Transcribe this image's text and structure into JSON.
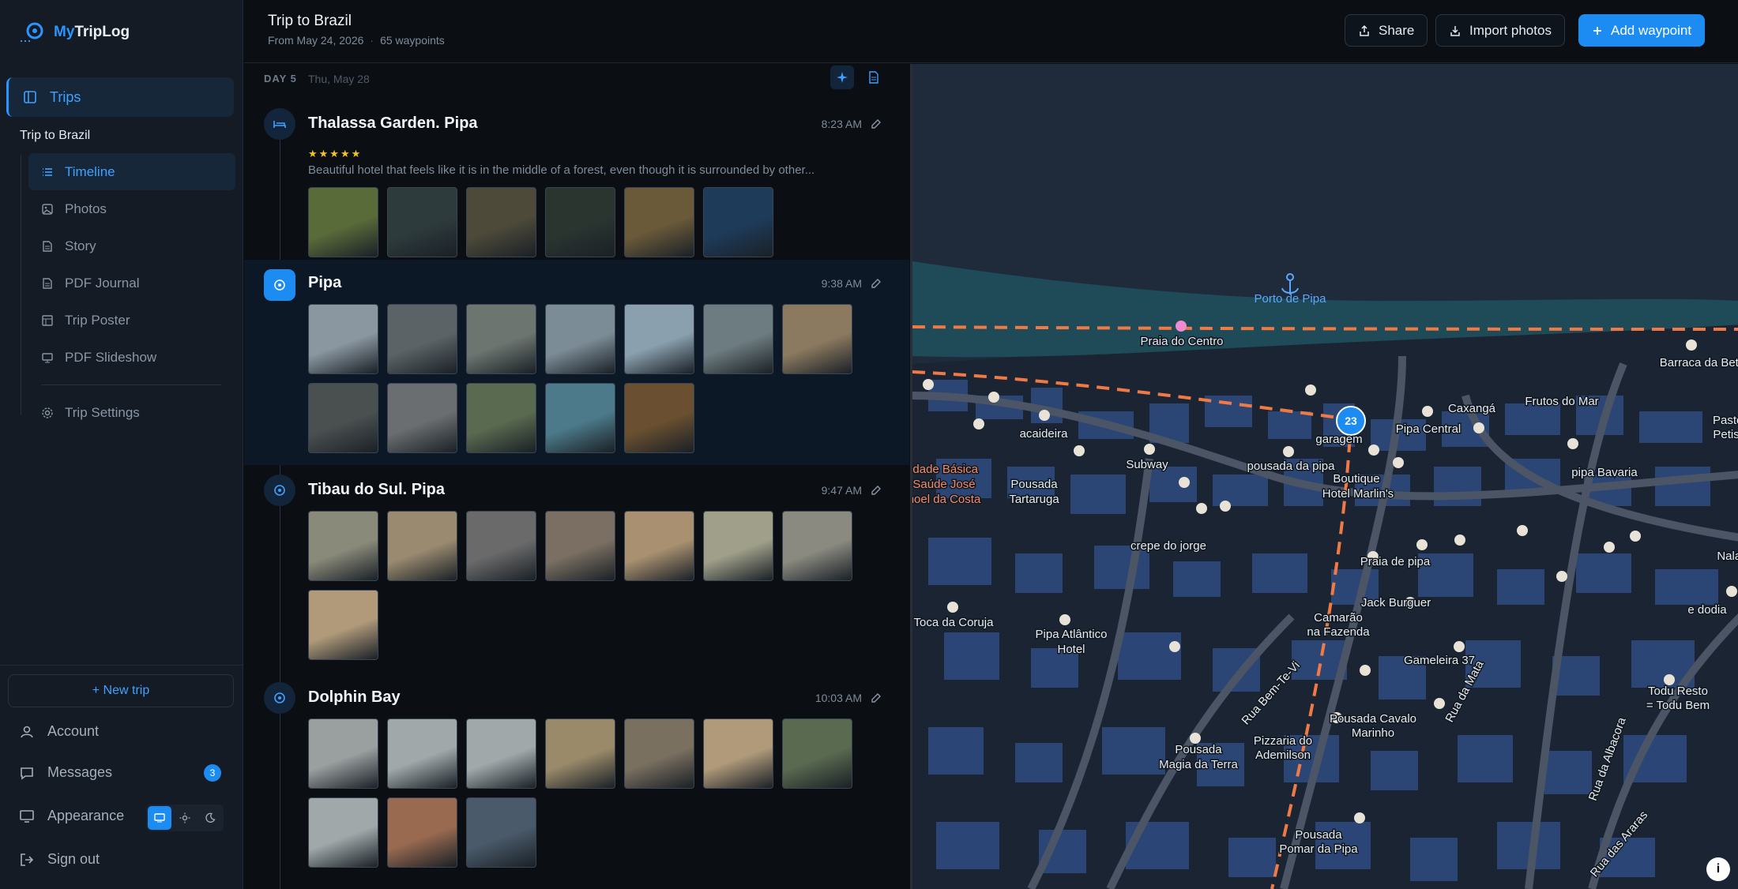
{
  "app": {
    "name_prefix": "My",
    "name_suffix": "TripLog"
  },
  "sidebar": {
    "trips_label": "Trips",
    "trip_title": "Trip to Brazil",
    "items": [
      {
        "label": "Timeline",
        "icon": "list-icon",
        "active": true
      },
      {
        "label": "Photos",
        "icon": "image-icon"
      },
      {
        "label": "Story",
        "icon": "document-icon"
      },
      {
        "label": "PDF Journal",
        "icon": "document-icon"
      },
      {
        "label": "Trip Poster",
        "icon": "poster-icon"
      },
      {
        "label": "PDF Slideshow",
        "icon": "monitor-icon"
      }
    ],
    "settings_label": "Trip Settings",
    "new_trip_label": "+ New trip",
    "account_label": "Account",
    "messages_label": "Messages",
    "messages_count": "3",
    "appearance_label": "Appearance",
    "sign_out_label": "Sign out"
  },
  "header": {
    "title": "Trip to Brazil",
    "date": "From May 24, 2026",
    "waypoints": "65 waypoints",
    "share_label": "Share",
    "import_label": "Import photos",
    "add_label": "Add waypoint"
  },
  "day": {
    "label": "DAY 5",
    "date": "Thu, May 28"
  },
  "waypoints": [
    {
      "title": "Thalassa Garden. Pipa",
      "time": "8:23 AM",
      "stars": "★★★★★",
      "description": "Beautiful hotel that feels like it is in the middle of a forest, even though it is surrounded by other...",
      "photo_colors": [
        "#5a6b3a",
        "#2e3b3d",
        "#4d4a3a",
        "#2a3530",
        "#6b5a3a",
        "#1e3b5a"
      ]
    },
    {
      "title": "Pipa",
      "time": "9:38 AM",
      "photo_colors": [
        "#8a97a0",
        "#5c6366",
        "#6d7570",
        "#7c8c96",
        "#8aa0ae",
        "#6d7c80",
        "#8c7a60",
        "#4a5050",
        "#6a6e70",
        "#5a6a50",
        "#4c7a8a",
        "#6a5030"
      ]
    },
    {
      "title": "Tibau do Sul. Pipa",
      "time": "9:47 AM",
      "photo_colors": [
        "#8a8a7a",
        "#9a8a70",
        "#6a6a6a",
        "#7a6f62",
        "#a89070",
        "#a0a08a",
        "#8a8a80",
        "#b09a7a"
      ]
    },
    {
      "title": "Dolphin Bay",
      "time": "10:03 AM",
      "photo_colors": [
        "#9aa0a0",
        "#a0a8aa",
        "#a0a8aa",
        "#9a8a6a",
        "#7a7060",
        "#b09a7a",
        "#5a6a50",
        "#a0a8aa",
        "#9a6a50",
        "#4a5a6a"
      ]
    }
  ],
  "map": {
    "harbor_label": "Porto de Pipa",
    "cluster_count": "23",
    "labels": [
      "Praia do Centro",
      "Barraca da Beta",
      "Frutos do Mar",
      "Caxangá",
      "Pipa Central",
      "garagem",
      "acaideira",
      "Subway",
      "pousada da pipa",
      "Boutique",
      "Hotel Marlin's",
      "pipa Bavaria",
      "Pastela",
      "Petisca",
      "idade Básica",
      "Saúde José",
      "noel da Costa",
      "Pousada",
      "Tartaruga",
      "crepe do jorge",
      "Praia de pipa",
      "Jack Burguer",
      "Camarão",
      "na Fazenda",
      "Toca da Coruja",
      "Pipa Atlântico",
      "Hotel",
      "Gameleira 37",
      "Rua Bem-Te-Vi",
      "Rua da Mata",
      "Pousada Cavalo",
      "Marinho",
      "Pizzaria do",
      "Ademilson",
      "Pousada",
      "Magia da Terra",
      "Todu Resto",
      "= Todu Bem",
      "Rua da Albacora",
      "Pousada",
      "Pomar da Pipa",
      "Rua das Araras",
      "Nala d",
      "e dodia"
    ],
    "accent_route": "#f07a45",
    "water": "#1f4a57",
    "land": "#1b2433"
  },
  "colors": {
    "accent": "#1d8cf2",
    "sidebar_bg": "#141b24",
    "page_bg": "#0b0f14"
  }
}
